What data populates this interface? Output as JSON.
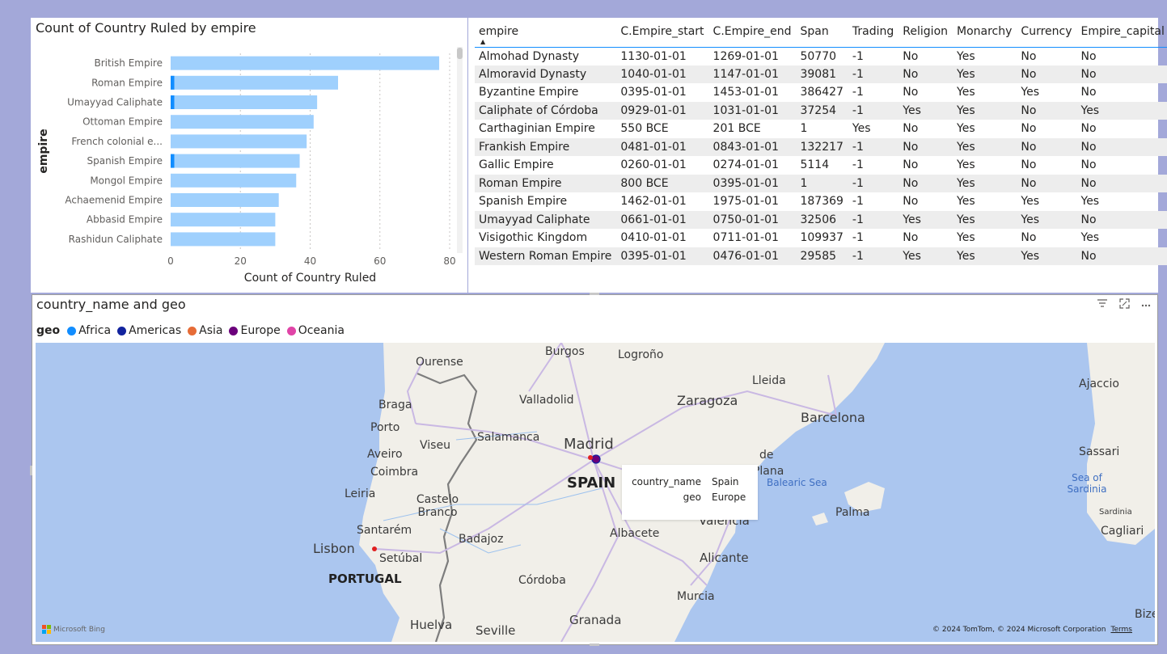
{
  "bar_chart": {
    "title": "Count of Country Ruled by empire",
    "chart_data": {
      "type": "bar",
      "orientation": "horizontal",
      "categories": [
        "British Empire",
        "Roman Empire",
        "Umayyad Caliphate",
        "Ottoman Empire",
        "French colonial e...",
        "Spanish Empire",
        "Mongol Empire",
        "Achaemenid Empire",
        "Abbasid Empire",
        "Rashidun Caliphate"
      ],
      "values": [
        77,
        48,
        42,
        41,
        39,
        37,
        36,
        31,
        30,
        30
      ],
      "highlighted": [
        0,
        1,
        1,
        0,
        0,
        1,
        0,
        0,
        0,
        0
      ],
      "xlabel": "Count of Country Ruled",
      "ylabel": "empire",
      "xlim": [
        0,
        80
      ],
      "xticks": [
        "0",
        "20",
        "40",
        "60",
        "80"
      ],
      "colors": {
        "bar": "#9fd0fd",
        "highlight": "#118dff",
        "grid": "#c8c6c4"
      },
      "grid": true
    }
  },
  "table": {
    "columns": [
      "empire",
      "C.Empire_start",
      "C.Empire_end",
      "Span",
      "Trading",
      "Religion",
      "Monarchy",
      "Currency",
      "Empire_capital"
    ],
    "sort_caret": "▲",
    "rows": [
      [
        "Almohad Dynasty",
        "1130-01-01",
        "1269-01-01",
        "50770",
        "-1",
        "No",
        "Yes",
        "No",
        "No"
      ],
      [
        "Almoravid Dynasty",
        "1040-01-01",
        "1147-01-01",
        "39081",
        "-1",
        "No",
        "Yes",
        "No",
        "No"
      ],
      [
        "Byzantine Empire",
        "0395-01-01",
        "1453-01-01",
        "386427",
        "-1",
        "No",
        "Yes",
        "Yes",
        "No"
      ],
      [
        "Caliphate of Córdoba",
        "0929-01-01",
        "1031-01-01",
        "37254",
        "-1",
        "Yes",
        "Yes",
        "No",
        "Yes"
      ],
      [
        "Carthaginian Empire",
        "550 BCE",
        "201 BCE",
        "1",
        "Yes",
        "No",
        "Yes",
        "No",
        "No"
      ],
      [
        "Frankish Empire",
        "0481-01-01",
        "0843-01-01",
        "132217",
        "-1",
        "No",
        "Yes",
        "No",
        "No"
      ],
      [
        "Gallic Empire",
        "0260-01-01",
        "0274-01-01",
        "5114",
        "-1",
        "No",
        "Yes",
        "No",
        "No"
      ],
      [
        "Roman Empire",
        "800 BCE",
        "0395-01-01",
        "1",
        "-1",
        "No",
        "Yes",
        "No",
        "No"
      ],
      [
        "Spanish Empire",
        "1462-01-01",
        "1975-01-01",
        "187369",
        "-1",
        "No",
        "Yes",
        "Yes",
        "Yes"
      ],
      [
        "Umayyad Caliphate",
        "0661-01-01",
        "0750-01-01",
        "32506",
        "-1",
        "Yes",
        "Yes",
        "Yes",
        "No"
      ],
      [
        "Visigothic Kingdom",
        "0410-01-01",
        "0711-01-01",
        "109937",
        "-1",
        "No",
        "Yes",
        "No",
        "Yes"
      ],
      [
        "Western Roman Empire",
        "0395-01-01",
        "0476-01-01",
        "29585",
        "-1",
        "Yes",
        "Yes",
        "Yes",
        "No"
      ]
    ]
  },
  "map": {
    "title": "country_name and geo",
    "legend": {
      "title": "geo",
      "items": [
        {
          "label": "Africa",
          "color": "#118dff"
        },
        {
          "label": "Americas",
          "color": "#12239e"
        },
        {
          "label": "Asia",
          "color": "#e66c37"
        },
        {
          "label": "Europe",
          "color": "#6b007b"
        },
        {
          "label": "Oceania",
          "color": "#e044a7"
        }
      ]
    },
    "icons": [
      "filter-icon",
      "focus-mode-icon",
      "more-options-icon"
    ],
    "tooltip": {
      "rows": [
        {
          "label": "country_name",
          "value": "Spain"
        },
        {
          "label": "geo",
          "value": "Europe"
        }
      ]
    },
    "labels": {
      "burgos": "Burgos",
      "logrono": "Logroño",
      "ourense": "Ourense",
      "lleida": "Lleida",
      "ajaccio": "Ajaccio",
      "valladolid": "Valladolid",
      "zaragoza": "Zaragoza",
      "braga": "Braga",
      "barcelona": "Barcelona",
      "porto": "Porto",
      "salamanca": "Salamanca",
      "madrid": "Madrid",
      "viseu": "Viseu",
      "aveiro": "Aveiro",
      "sassari": "Sassari",
      "coimbra": "Coimbra",
      "spain": "SPAIN",
      "balearic_sea": "Balearic Sea",
      "sea_of_sardinia": "Sea of Sardinia",
      "leiria": "Leiria",
      "castelo_branco": "Castelo Branco",
      "palma": "Palma",
      "valencia": "Valencia",
      "sardinia": "Sardinia",
      "santarem": "Santarém",
      "badajoz": "Badajoz",
      "albacete": "Albacete",
      "cagliari": "Cagliari",
      "lisbon": "Lisbon",
      "setubal": "Setúbal",
      "alicante": "Alicante",
      "portugal": "PORTUGAL",
      "cordoba": "Córdoba",
      "murcia": "Murcia",
      "huelva": "Huelva",
      "granada": "Granada",
      "seville": "Seville",
      "bize": "Bize",
      "de": "de",
      "la_plana": "la Plana"
    },
    "attribution": {
      "provider": "Microsoft Bing",
      "copyright": "© 2024 TomTom, © 2024 Microsoft Corporation",
      "terms": "Terms"
    }
  }
}
